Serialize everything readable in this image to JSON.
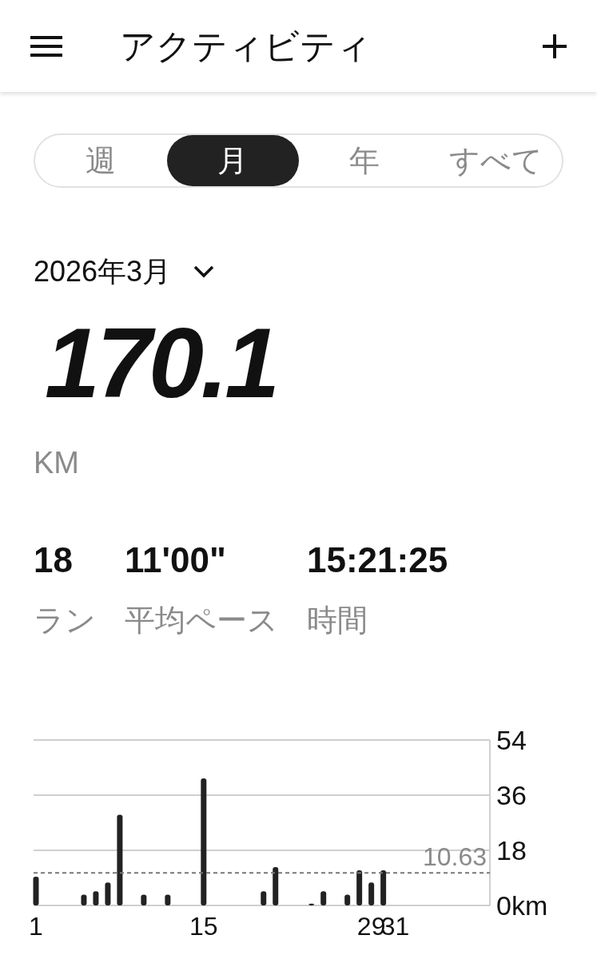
{
  "header": {
    "title": "アクティビティ"
  },
  "tabs": [
    {
      "label": "週",
      "selected": false
    },
    {
      "label": "月",
      "selected": true
    },
    {
      "label": "年",
      "selected": false
    },
    {
      "label": "すべて",
      "selected": false
    }
  ],
  "period": {
    "label": "2026年3月"
  },
  "total": {
    "value": "170.1",
    "unit": "KM"
  },
  "stats": [
    {
      "value": "18",
      "label": "ラン"
    },
    {
      "value": "11'00\"",
      "label": "平均ペース"
    },
    {
      "value": "15:21:25",
      "label": "時間"
    }
  ],
  "chart": {
    "chart_data": {
      "type": "bar",
      "x": [
        1,
        5,
        6,
        7,
        8,
        10,
        12,
        15,
        20,
        21,
        24,
        25,
        27,
        28,
        29,
        30
      ],
      "series": [
        {
          "color": "#222222",
          "values": [
            9.4,
            3.5,
            4.6,
            7.5,
            29.6,
            3.5,
            3.5,
            41.5,
            4.6,
            12.5,
            0.6,
            4.6,
            3.5,
            11.5,
            7.5,
            11.5
          ]
        }
      ],
      "xlim": [
        0.8,
        38.9
      ],
      "ylim": [
        0,
        54
      ],
      "xticks": [
        1,
        15,
        29,
        31
      ],
      "yticks": [
        {
          "value": 0,
          "label": "0km"
        },
        {
          "value": 18,
          "label": "18"
        },
        {
          "value": 36,
          "label": "36"
        },
        {
          "value": 54,
          "label": "54"
        }
      ],
      "ref_lines": [
        {
          "axis": "y",
          "value": 10.63,
          "label": "10.63"
        }
      ]
    }
  }
}
